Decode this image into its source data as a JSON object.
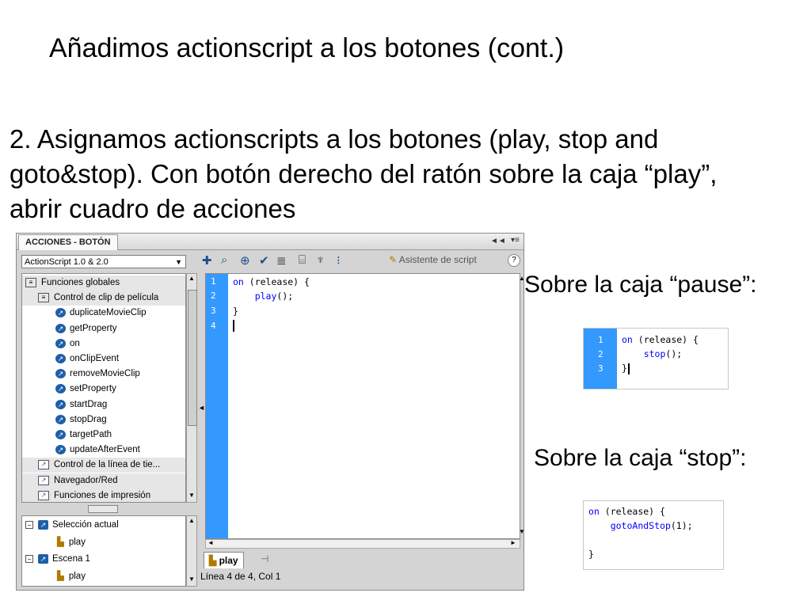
{
  "slide": {
    "title": "Añadimos actionscript a los botones (cont.)",
    "para_line1": "2. Asignamos actionscripts a los botones (play, stop and",
    "para_line2": "goto&stop). Con botón derecho del ratón sobre la caja “play”,",
    "para_line3": "abrir cuadro de acciones",
    "caption_pause": "Sobre la caja “pause”:",
    "caption_stop": "Sobre la caja “stop”:"
  },
  "panel": {
    "tab_label": "ACCIONES - BOTÓN",
    "version_select": "ActionScript 1.0 & 2.0",
    "assistant_label": "Asistente de script",
    "help_label": "?",
    "tree_items": [
      {
        "label": "Funciones globales",
        "kind": "folder"
      },
      {
        "label": "Control de clip de película",
        "kind": "folder"
      },
      {
        "label": "duplicateMovieClip",
        "kind": "item"
      },
      {
        "label": "getProperty",
        "kind": "item"
      },
      {
        "label": "on",
        "kind": "item"
      },
      {
        "label": "onClipEvent",
        "kind": "item"
      },
      {
        "label": "removeMovieClip",
        "kind": "item"
      },
      {
        "label": "setProperty",
        "kind": "item"
      },
      {
        "label": "startDrag",
        "kind": "item"
      },
      {
        "label": "stopDrag",
        "kind": "item"
      },
      {
        "label": "targetPath",
        "kind": "item"
      },
      {
        "label": "updateAfterEvent",
        "kind": "item"
      },
      {
        "label": "Control de la línea de tie...",
        "kind": "group"
      },
      {
        "label": "Navegador/Red",
        "kind": "group"
      },
      {
        "label": "Funciones de impresión",
        "kind": "group"
      }
    ],
    "scene_tree": [
      {
        "label": "Selección actual",
        "kind": "root"
      },
      {
        "label": "play",
        "kind": "child"
      },
      {
        "label": "Escena 1",
        "kind": "root"
      },
      {
        "label": "play",
        "kind": "child"
      }
    ],
    "line_numbers": [
      "1",
      "2",
      "3",
      "4"
    ],
    "code": {
      "l1_kw": "on",
      "l1_rest": " (release) {",
      "l2_kw": "play",
      "l2_rest": "();",
      "l3": "}"
    },
    "bottom_tab": "play",
    "status": "Línea 4 de 4, Col 1"
  },
  "snippet_pause": {
    "line_numbers": [
      "1",
      "2",
      "3"
    ],
    "l1_kw": "on",
    "l1_rest": " (release) {",
    "l2_kw": "stop",
    "l2_rest": "();",
    "l3": "}"
  },
  "snippet_stop": {
    "l1_kw": "on",
    "l1_rest": " (release) {",
    "l2_kw": "gotoAndStop",
    "l2_rest": "(1);",
    "l3": "}"
  },
  "colors": {
    "gutter": "#3399ff",
    "keyword": "#0000ff",
    "icon_blue": "#1d5fa8"
  }
}
